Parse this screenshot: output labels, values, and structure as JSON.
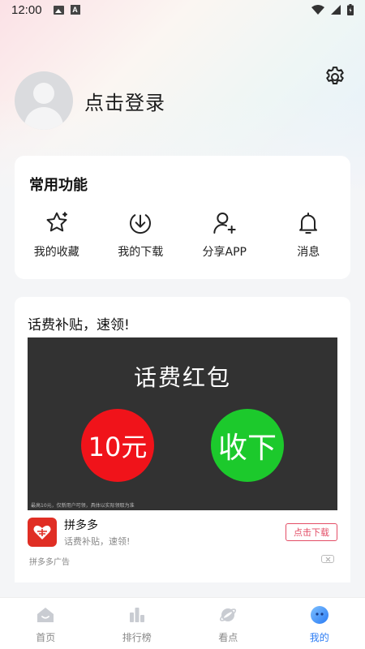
{
  "status_bar": {
    "time": "12:00"
  },
  "profile": {
    "login_text": "点击登录"
  },
  "functions": {
    "title": "常用功能",
    "items": [
      {
        "label": "我的收藏",
        "icon": "star-icon"
      },
      {
        "label": "我的下载",
        "icon": "download-icon"
      },
      {
        "label": "分享APP",
        "icon": "share-user-icon"
      },
      {
        "label": "消息",
        "icon": "bell-icon"
      }
    ]
  },
  "ad": {
    "title": "话费补贴，速领!",
    "banner_heading": "话费红包",
    "red_circle": "10元",
    "green_circle": "收下",
    "fine_print": "最高10元，仅新用户可领，具体以实际领取为准",
    "app_name": "拼多多",
    "app_desc": "话费补贴，速领!",
    "download_label": "点击下载",
    "source": "拼多多广告",
    "colors": {
      "red": "#f0131a",
      "green": "#1cc92c",
      "brand": "#e02e24"
    }
  },
  "tabbar": {
    "items": [
      {
        "label": "首页",
        "icon": "home-icon",
        "active": false
      },
      {
        "label": "排行榜",
        "icon": "ranking-icon",
        "active": false
      },
      {
        "label": "看点",
        "icon": "planet-icon",
        "active": false
      },
      {
        "label": "我的",
        "icon": "profile-face-icon",
        "active": true
      }
    ],
    "active_color": "#2a7bf4"
  }
}
